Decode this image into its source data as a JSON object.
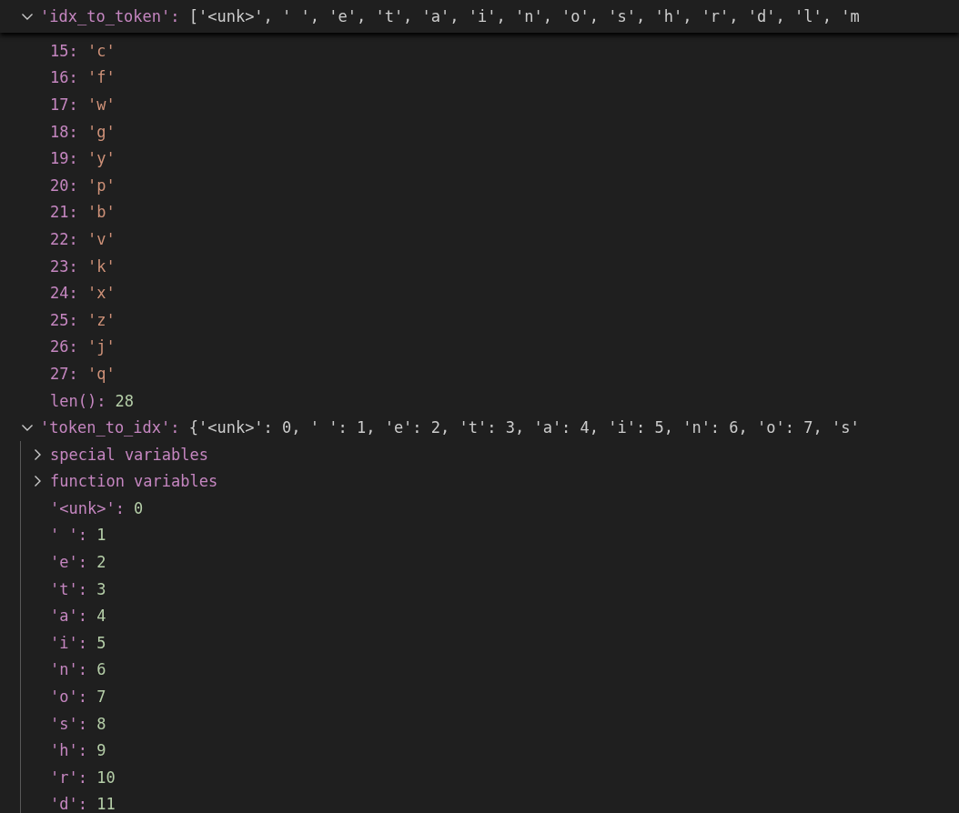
{
  "variables": [
    {
      "name": "'idx_to_token':",
      "value": "['<unk>', ' ', 'e', 't', 'a', 'i', 'n', 'o', 's', 'h', 'r', 'd', 'l', 'm",
      "kind": "group",
      "expanded": true,
      "guides_visible": false,
      "children": [
        {
          "name": "15:",
          "value": "'c'",
          "kind": "string"
        },
        {
          "name": "16:",
          "value": "'f'",
          "kind": "string"
        },
        {
          "name": "17:",
          "value": "'w'",
          "kind": "string"
        },
        {
          "name": "18:",
          "value": "'g'",
          "kind": "string"
        },
        {
          "name": "19:",
          "value": "'y'",
          "kind": "string"
        },
        {
          "name": "20:",
          "value": "'p'",
          "kind": "string"
        },
        {
          "name": "21:",
          "value": "'b'",
          "kind": "string"
        },
        {
          "name": "22:",
          "value": "'v'",
          "kind": "string"
        },
        {
          "name": "23:",
          "value": "'k'",
          "kind": "string"
        },
        {
          "name": "24:",
          "value": "'x'",
          "kind": "string"
        },
        {
          "name": "25:",
          "value": "'z'",
          "kind": "string"
        },
        {
          "name": "26:",
          "value": "'j'",
          "kind": "string"
        },
        {
          "name": "27:",
          "value": "'q'",
          "kind": "string"
        },
        {
          "name": "len():",
          "value": "28",
          "kind": "number"
        }
      ]
    },
    {
      "name": "'token_to_idx':",
      "value": "{'<unk>': 0, ' ': 1, 'e': 2, 't': 3, 'a': 4, 'i': 5, 'n': 6, 'o': 7, 's'",
      "kind": "group",
      "expanded": true,
      "guides_visible": true,
      "children": [
        {
          "name": "special variables",
          "kind": "group",
          "expanded": false
        },
        {
          "name": "function variables",
          "kind": "group",
          "expanded": false
        },
        {
          "name": "'<unk>':",
          "value": "0",
          "kind": "number"
        },
        {
          "name": "' ':",
          "value": "1",
          "kind": "number"
        },
        {
          "name": "'e':",
          "value": "2",
          "kind": "number"
        },
        {
          "name": "'t':",
          "value": "3",
          "kind": "number"
        },
        {
          "name": "'a':",
          "value": "4",
          "kind": "number"
        },
        {
          "name": "'i':",
          "value": "5",
          "kind": "number"
        },
        {
          "name": "'n':",
          "value": "6",
          "kind": "number"
        },
        {
          "name": "'o':",
          "value": "7",
          "kind": "number"
        },
        {
          "name": "'s':",
          "value": "8",
          "kind": "number"
        },
        {
          "name": "'h':",
          "value": "9",
          "kind": "number"
        },
        {
          "name": "'r':",
          "value": "10",
          "kind": "number"
        },
        {
          "name": "'d':",
          "value": "11",
          "kind": "number"
        }
      ]
    }
  ]
}
